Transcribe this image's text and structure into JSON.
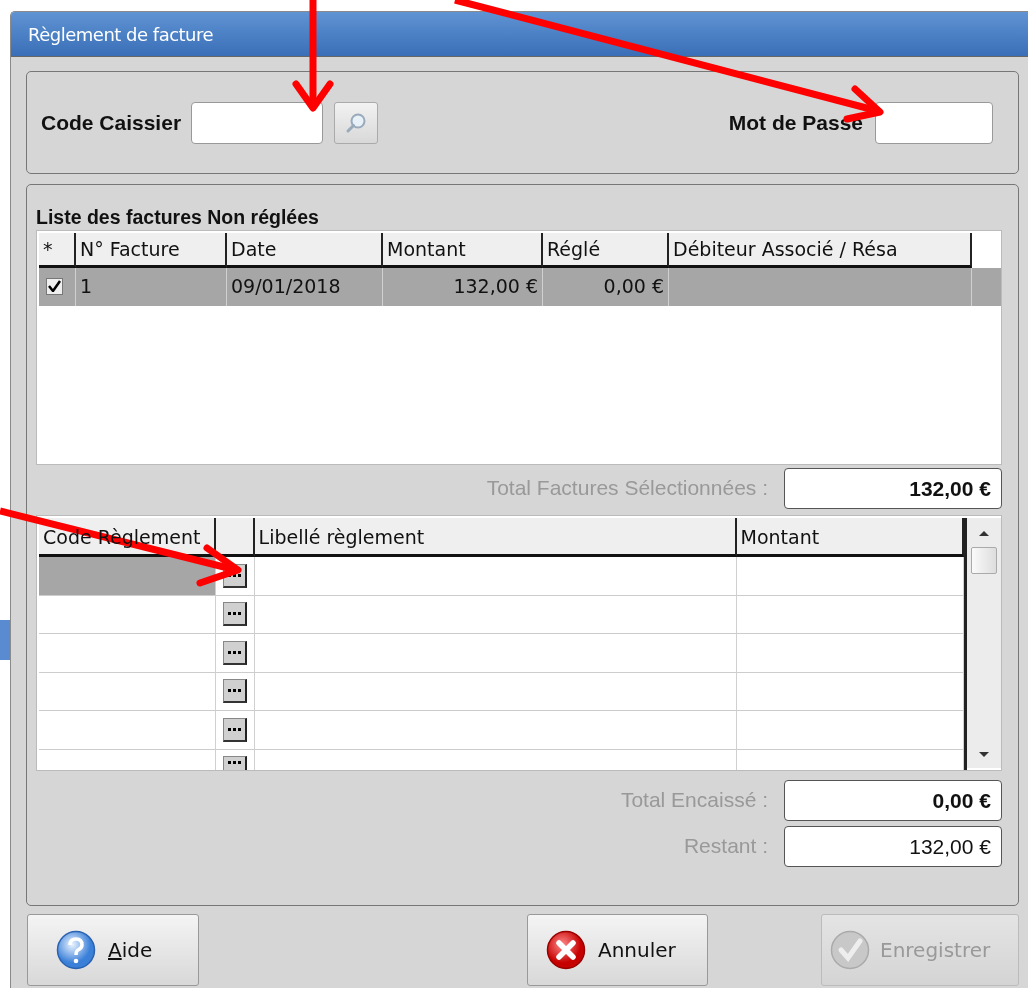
{
  "window": {
    "title": "Règlement de facture"
  },
  "login": {
    "cashier": {
      "label": "Code Caissier"
    },
    "password": {
      "label": "Mot de Passe"
    }
  },
  "invoices": {
    "title": "Liste des factures Non réglées",
    "check_column": "*",
    "columns": [
      "N° Facture",
      "Date",
      "Montant",
      "Réglé",
      "Débiteur Associé / Résa"
    ],
    "rows": [
      {
        "checked": true,
        "selected": true,
        "cells": [
          "1",
          "09/01/2018",
          "132,00 €",
          "0,00 €"
        ]
      }
    ]
  },
  "total_selected": {
    "label": "Total Factures Sélectionnées :",
    "value": "132,00 €",
    "emphasized": true
  },
  "payments": {
    "columns": [
      {
        "kind": "text",
        "label": "Code Règlement"
      },
      {
        "kind": "button"
      },
      {
        "kind": "text",
        "label": "Libellé règlement"
      },
      {
        "kind": "text",
        "label": "Montant"
      }
    ],
    "rows": [
      {
        "selected": true
      },
      {
        "selected": false
      },
      {
        "selected": false
      },
      {
        "selected": false
      },
      {
        "selected": false
      },
      {
        "selected": false
      }
    ]
  },
  "totals": [
    {
      "label": "Total Encaissé :",
      "value": "0,00 €",
      "emphasized": true
    },
    {
      "label": "Restant :",
      "value": "132,00 €",
      "emphasized": false
    }
  ],
  "buttons": [
    {
      "kind": "help",
      "label": "Aide",
      "first_letter_underlined": true,
      "disabled": false
    },
    {
      "kind": "cancel",
      "label": "Annuler",
      "disabled": false
    },
    {
      "kind": "save",
      "label": "Enregistrer",
      "disabled": true
    }
  ],
  "annotations": [
    {
      "kind": "arrow"
    },
    {
      "kind": "arrow"
    },
    {
      "kind": "arrow"
    }
  ]
}
